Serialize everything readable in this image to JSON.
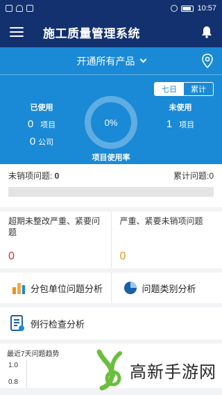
{
  "status_bar": {
    "time": "10:57"
  },
  "nav": {
    "title": "施工质量管理系统"
  },
  "hero": {
    "product_select": "开通所有产品",
    "tabs": [
      "七日",
      "累计"
    ],
    "active_tab": "七日",
    "used": {
      "title": "已使用",
      "project_count": "0",
      "project_unit": "项目",
      "company_count": "0",
      "company_unit": "公司"
    },
    "unused": {
      "title": "未使用",
      "project_count": "1",
      "project_unit": "项目"
    },
    "usage_rate": {
      "value": "0%",
      "label": "项目使用率"
    }
  },
  "issues": {
    "unsold_label": "未销项问题: ",
    "unsold_value": "0",
    "total_label": "累计问题:",
    "total_value": "0",
    "progress": 0
  },
  "severity": {
    "overdue": {
      "title": "超期未整改严重、紧要问题",
      "value": "0",
      "color": "#c0392b"
    },
    "serious": {
      "title": "严重、紧要未销项问题",
      "value": "0",
      "color": "#e8951c"
    }
  },
  "analysis": {
    "subcontract": "分包单位问题分析",
    "category": "问题类别分析",
    "routine": "例行检查分析"
  },
  "trend": {
    "title": "最近7天问题趋势",
    "ticks": [
      "1.0",
      "0.8"
    ]
  },
  "watermark": {
    "text": "高新手游网"
  },
  "colors": {
    "nav": "#13316e",
    "hero": "#1a8ad6"
  }
}
